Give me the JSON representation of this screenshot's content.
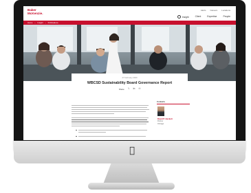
{
  "header": {
    "logo": "Baker McKenzie.",
    "util_links": [
      "Alerts",
      "Careers",
      "Locations"
    ],
    "nav": [
      "Insight",
      "Client",
      "Expertise",
      "People"
    ]
  },
  "breadcrumb": [
    "Home",
    "Insight",
    "Publications"
  ],
  "article": {
    "date": "27 February 2020",
    "title": "WBCSD Sustainability Board Governance Report",
    "share_label": "Share"
  },
  "sidebar": {
    "title": "Contacts",
    "person_name": "David P. Huckett",
    "person_role": "Partner",
    "person_city": "Chicago"
  },
  "icons": [
    "search-icon",
    "twitter-icon",
    "linkedin-icon",
    "email-icon",
    "apple-logo-icon"
  ],
  "colors": {
    "brand": "#c8102e",
    "bezel": "#151515"
  }
}
